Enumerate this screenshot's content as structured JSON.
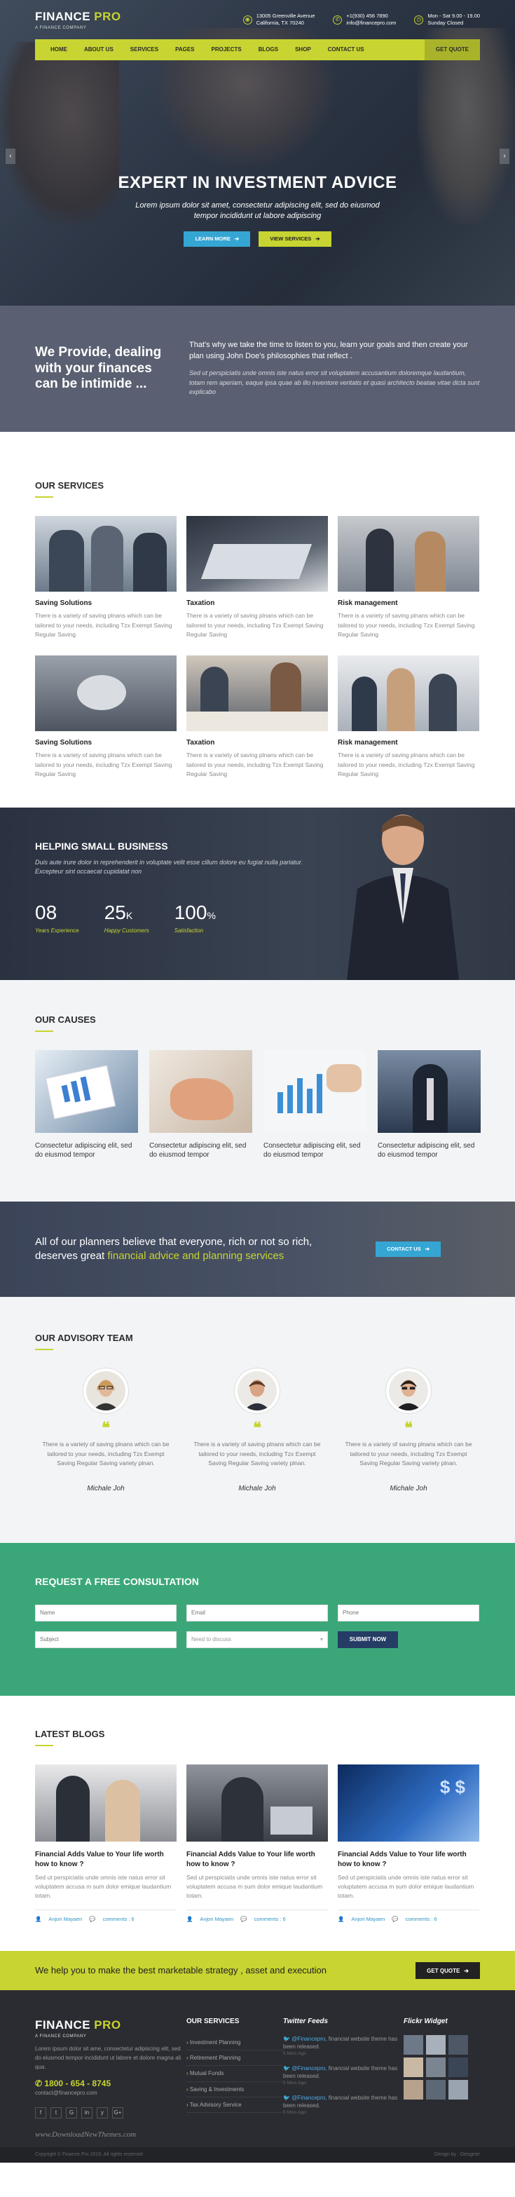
{
  "brand": {
    "name": "FINANCE",
    "accent": "PRO",
    "tagline": "A FINANCE COMPANY"
  },
  "topbar": {
    "address": {
      "line1": "13005 Greenville Avenue",
      "line2": "California, TX 70240"
    },
    "phone": {
      "line1": "+1(930) 456 7890",
      "line2": "info@financepro.com"
    },
    "hours": {
      "line1": "Mon - Sat 9.00 - 19.00",
      "line2": "Sunday Closed"
    }
  },
  "nav": {
    "items": [
      "HOME",
      "ABOUT US",
      "SERVICES",
      "PAGES",
      "PROJECTS",
      "BLOGS",
      "SHOP",
      "CONTACT US"
    ],
    "cta": "GET QUOTE"
  },
  "hero": {
    "title": "EXPERT IN INVESTMENT ADVICE",
    "subtitle_1": "Lorem ipsum dolor sit amet, consectetur adipiscing elit, sed do eiusmod",
    "subtitle_2": "tempor incididunt ut labore adipiscing",
    "btn_learn": "LEARN MORE",
    "btn_services": "VIEW SERVICES"
  },
  "provide": {
    "heading": "We Provide, dealing with your finances can be intimide ...",
    "lead": "That's why we take the time to listen to you, learn your goals and then create your plan using John Doe's philosophies that reflect .",
    "body": "Sed ut perspiciatis unde omnis iste natus error sit voluptatem accusantium doloremque laudantium, totam rem aperiam, eaque ipsa quae ab illo inventore veritatis et quasi architecto beatae vitae dicta sunt explicabo"
  },
  "services": {
    "title": "OUR SERVICES",
    "items": [
      {
        "title": "Saving Solutions",
        "text": "There is a variety of saving plnans which can be tailored to your needs, including Tzx Exempt Saving Regular Saving"
      },
      {
        "title": "Taxation",
        "text": "There is a variety of saving plnans which can be tailored to your needs, including Tzx Exempt Saving Regular Saving"
      },
      {
        "title": "Risk management",
        "text": "There is a variety of saving plnans which can be tailored to your needs, including Tzx Exempt Saving Regular Saving"
      },
      {
        "title": "Saving Solutions",
        "text": "There is a variety of saving plnans which can be tailored to your needs, including Tzx Exempt Saving Regular Saving"
      },
      {
        "title": "Taxation",
        "text": "There is a variety of saving plnans which can be tailored to your needs, including Tzx Exempt Saving Regular Saving"
      },
      {
        "title": "Risk management",
        "text": "There is a variety of saving plnans which can be tailored to your needs, including Tzx Exempt Saving Regular Saving"
      }
    ]
  },
  "helping": {
    "title": "HELPING SMALL BUSINESS",
    "text": "Duis aute irure dolor in reprehenderit in voluptate velit esse cillum dolore eu fugiat nulla pariatur. Excepteur sint occaecat cupidatat non",
    "stats": [
      {
        "value": "08",
        "suffix": "",
        "label": "Years Experience"
      },
      {
        "value": "25",
        "suffix": "K",
        "label": "Happy Customers"
      },
      {
        "value": "100",
        "suffix": "%",
        "label": "Satisfaction"
      }
    ]
  },
  "causes": {
    "title": "OUR CAUSES",
    "items": [
      "Consectetur adipiscing elit, sed do eiusmod tempor",
      "Consectetur adipiscing elit, sed do eiusmod tempor",
      "Consectetur adipiscing elit, sed do eiusmod tempor",
      "Consectetur adipiscing elit, sed do eiusmod tempor"
    ]
  },
  "banner": {
    "line1": "All of our planners believe that everyone, rich or not so rich,",
    "line2_plain": "deserves great ",
    "line2_highlight": "financial advice and planning services",
    "btn": "CONTACT US"
  },
  "team": {
    "title": "OUR ADVISORY TEAM",
    "members": [
      {
        "text": "There is a variety of saving plnans which can be tailored to your needs, including Tzx Exempt Saving Regular Saving variety plnan.",
        "name": "Michale Joh"
      },
      {
        "text": "There is a variety of saving plnans which can be tailored to your needs, including Tzx Exempt Saving Regular Saving variety plnan.",
        "name": "Michale Joh"
      },
      {
        "text": "There is a variety of saving plnans which can be tailored to your needs, including Tzx Exempt Saving Regular Saving variety plnan.",
        "name": "Michale Joh"
      }
    ]
  },
  "consult": {
    "title": "REQUEST A FREE CONSULTATION",
    "name_ph": "Name",
    "email_ph": "Email",
    "phone_ph": "Phone",
    "subject_ph": "Subject",
    "discuss": "Need to discuss",
    "submit": "SUBMIT NOW"
  },
  "blogs": {
    "title": "LATEST BLOGS",
    "items": [
      {
        "title": "Financial Adds Value to Your life worth how to know ?",
        "text": "Sed ut perspiciatis unde omnis iste natus error sit voluptatem accusa m sum dolor emique laudantium totam.",
        "author": "Anjori Mayaen",
        "comments": "comments : 6"
      },
      {
        "title": "Financial Adds Value to Your life worth how to know ?",
        "text": "Sed ut perspiciatis unde omnis iste natus error sit voluptatem accusa m sum dolor emique laudantium totam.",
        "author": "Anjori Mayaen",
        "comments": "comments : 6"
      },
      {
        "title": "Financial Adds Value to Your life worth how to know ?",
        "text": "Sed ut perspiciatis unde omnis iste natus error sit voluptatem accusa m sum dolor emique laudantium totam.",
        "author": "Anjori Mayaen",
        "comments": "comments : 6"
      }
    ]
  },
  "strip": {
    "text": "We help you to make the best marketable strategy , asset and execution",
    "btn": "GET QUOTE"
  },
  "footer": {
    "about": "Lorem ipsum dolor sit ame, consectetur adipiscing elit, sed do eiusmod tempor incididunt ut labore et dolore magna ali qua.",
    "phone": "1800 - 654 - 8745",
    "email": "contact@financepro.com",
    "socials": [
      "f",
      "t",
      "G",
      "in",
      "y",
      "G+"
    ],
    "watermark": "www.DownloadNewThemes.com",
    "services_title": "OUR SERVICES",
    "services": [
      "Investment Planning",
      "Retirement Planning",
      "Mutual Funds",
      "Saving & Investments",
      "Tax Advisory Service"
    ],
    "twitter_title": "Twitter Feeds",
    "tweets": [
      {
        "handle": "@Financepro,",
        "text": "financial website theme has been released.",
        "time": "5 Mins Ago"
      },
      {
        "handle": "@Financepro,",
        "text": "financial website theme has been released.",
        "time": "5 Mins Ago"
      },
      {
        "handle": "@Financepro,",
        "text": "financial website theme has been released.",
        "time": "5 Mins Ago"
      }
    ],
    "flickr_title": "Flickr Widget",
    "copyright": "Copyright © Finance Pro 2016. All rights reserved",
    "credit": "Design by : Designer"
  }
}
